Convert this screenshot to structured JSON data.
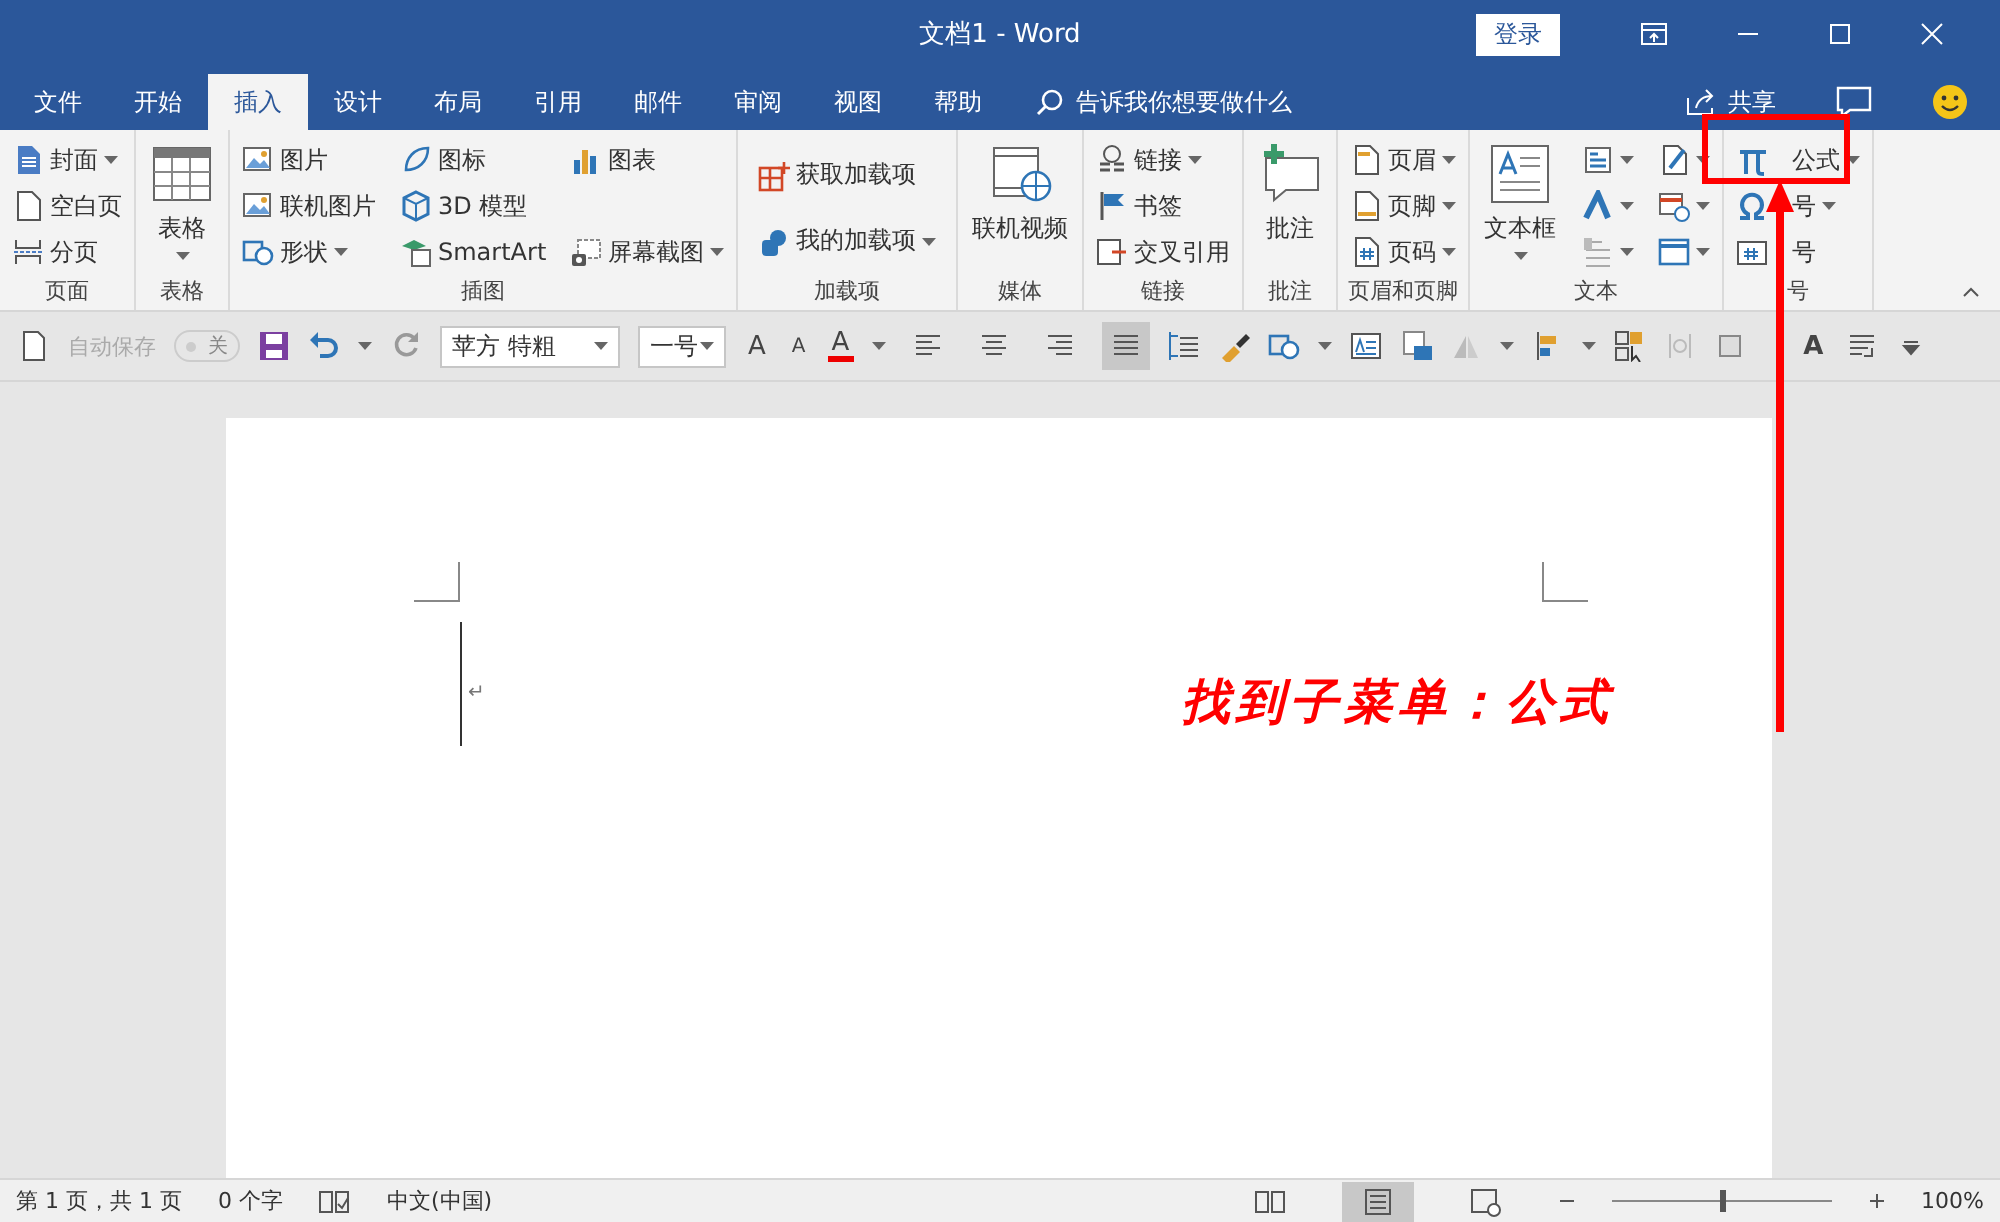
{
  "window": {
    "title": "文档1 - Word",
    "login_button": "登录"
  },
  "tabs": [
    {
      "label": "文件",
      "selected": false
    },
    {
      "label": "开始",
      "selected": false
    },
    {
      "label": "插入",
      "selected": true
    },
    {
      "label": "设计",
      "selected": false
    },
    {
      "label": "布局",
      "selected": false
    },
    {
      "label": "引用",
      "selected": false
    },
    {
      "label": "邮件",
      "selected": false
    },
    {
      "label": "审阅",
      "selected": false
    },
    {
      "label": "视图",
      "selected": false
    },
    {
      "label": "帮助",
      "selected": false
    }
  ],
  "tell_me": {
    "placeholder": "告诉我你想要做什么"
  },
  "share_button": "共享",
  "ribbon_groups": [
    {
      "label": "页面",
      "columns": [
        {
          "kind": "small",
          "items": [
            {
              "label": "封面",
              "dropdown": true
            },
            {
              "label": "空白页",
              "dropdown": false
            },
            {
              "label": "分页",
              "dropdown": false
            }
          ]
        }
      ]
    },
    {
      "label": "表格",
      "columns": [
        {
          "kind": "large",
          "items": [
            {
              "label": "表格",
              "dropdown": true
            }
          ]
        }
      ]
    },
    {
      "label": "插图",
      "columns": [
        {
          "kind": "small",
          "items": [
            {
              "label": "图片",
              "dropdown": false
            },
            {
              "label": "联机图片",
              "dropdown": false
            },
            {
              "label": "形状",
              "dropdown": true
            }
          ]
        },
        {
          "kind": "small",
          "items": [
            {
              "label": "图标",
              "dropdown": false
            },
            {
              "label": "3D 模型",
              "dropdown": false
            },
            {
              "label": "SmartArt",
              "dropdown": false
            }
          ]
        },
        {
          "kind": "small",
          "items": [
            {
              "label": "图表",
              "dropdown": false
            },
            {
              "label": "屏幕截图",
              "dropdown": true
            }
          ]
        }
      ]
    },
    {
      "label": "加载项",
      "columns": [
        {
          "kind": "spread",
          "items": [
            {
              "label": "获取加载项",
              "dropdown": false
            },
            {
              "label": "我的加载项",
              "dropdown": true
            }
          ]
        }
      ]
    },
    {
      "label": "媒体",
      "columns": [
        {
          "kind": "large",
          "items": [
            {
              "label": "联机视频",
              "dropdown": false
            }
          ]
        }
      ]
    },
    {
      "label": "链接",
      "columns": [
        {
          "kind": "small",
          "items": [
            {
              "label": "链接",
              "dropdown": true
            },
            {
              "label": "书签",
              "dropdown": false
            },
            {
              "label": "交叉引用",
              "dropdown": false
            }
          ]
        }
      ]
    },
    {
      "label": "批注",
      "columns": [
        {
          "kind": "large",
          "items": [
            {
              "label": "批注",
              "dropdown": false
            }
          ]
        }
      ]
    },
    {
      "label": "页眉和页脚",
      "columns": [
        {
          "kind": "small",
          "items": [
            {
              "label": "页眉",
              "dropdown": true
            },
            {
              "label": "页脚",
              "dropdown": true
            },
            {
              "label": "页码",
              "dropdown": true
            }
          ]
        }
      ]
    },
    {
      "label": "文本",
      "columns": [
        {
          "kind": "large",
          "items": [
            {
              "label": "文本框",
              "dropdown": true
            }
          ]
        },
        {
          "kind": "small",
          "items": [
            {
              "dropdown": true
            },
            {
              "dropdown": true
            },
            {
              "dropdown": true
            }
          ]
        },
        {
          "kind": "small",
          "items": [
            {
              "dropdown": true
            },
            {
              "dropdown": true
            },
            {
              "dropdown": true
            }
          ]
        }
      ]
    },
    {
      "label": "号",
      "columns": [
        {
          "kind": "small",
          "items": [
            {
              "label": "公式",
              "dropdown": true
            },
            {
              "label": "号",
              "dropdown": true
            },
            {
              "label": "号",
              "dropdown": false
            }
          ]
        }
      ]
    }
  ],
  "quick_access": {
    "autosave_label": "自动保存",
    "autosave_toggle": {
      "label": "关",
      "on": false
    },
    "font": "苹方 特粗",
    "size": "一号",
    "grow_font": "A",
    "shrink_font": "A",
    "font_color": "A",
    "text_effect": "A",
    "align_buttons": [
      {
        "selected": false
      },
      {
        "selected": false
      },
      {
        "selected": false
      },
      {
        "selected": true
      }
    ]
  },
  "document": {
    "paragraph_mark": "↵"
  },
  "annotation": {
    "text": "找到子菜单：公式"
  },
  "status_bar": {
    "page": "第 1 页，共 1 页",
    "words": "0 个字",
    "language": "中文(中国)",
    "views": [
      {
        "selected": false
      },
      {
        "selected": true
      },
      {
        "selected": false
      }
    ],
    "zoom_slider": {
      "level": 0.5
    },
    "zoom": "100%"
  }
}
